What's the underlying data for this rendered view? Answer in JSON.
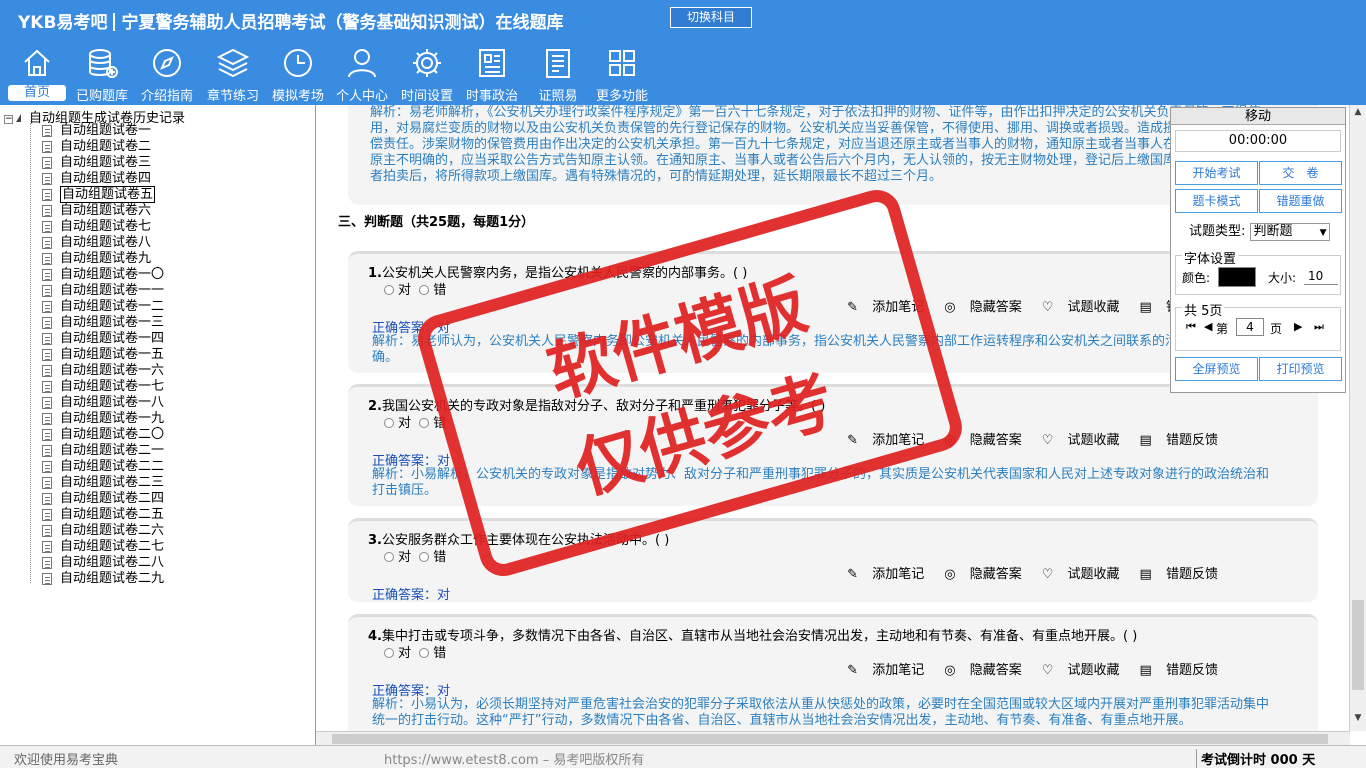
{
  "header": {
    "logo": "YKB易考吧",
    "title": "宁夏警务辅助人员招聘考试（警务基础知识测试）在线题库",
    "switch_label": "切换科目"
  },
  "nav": [
    {
      "label": "首页",
      "icon": "home-icon"
    },
    {
      "label": "已购题库",
      "icon": "database-icon"
    },
    {
      "label": "介绍指南",
      "icon": "compass-icon"
    },
    {
      "label": "章节练习",
      "icon": "layers-icon"
    },
    {
      "label": "模拟考场",
      "icon": "clock-icon"
    },
    {
      "label": "个人中心",
      "icon": "user-icon"
    },
    {
      "label": "时间设置",
      "icon": "gear-icon"
    },
    {
      "label": "时事政治",
      "icon": "news-icon"
    },
    {
      "label": "证照易",
      "icon": "certificate-icon"
    },
    {
      "label": "更多功能",
      "icon": "grid-icon"
    }
  ],
  "tree": {
    "root": "自动组题生成试卷历史记录",
    "items": [
      "自动组题试卷一",
      "自动组题试卷二",
      "自动组题试卷三",
      "自动组题试卷四",
      "自动组题试卷五",
      "自动组题试卷六",
      "自动组题试卷七",
      "自动组题试卷八",
      "自动组题试卷九",
      "自动组题试卷一〇",
      "自动组题试卷一一",
      "自动组题试卷一二",
      "自动组题试卷一三",
      "自动组题试卷一四",
      "自动组题试卷一五",
      "自动组题试卷一六",
      "自动组题试卷一七",
      "自动组题试卷一八",
      "自动组题试卷一九",
      "自动组题试卷二〇",
      "自动组题试卷二一",
      "自动组题试卷二二",
      "自动组题试卷二三",
      "自动组题试卷二四",
      "自动组题试卷二五",
      "自动组题试卷二六",
      "自动组题试卷二七",
      "自动组题试卷二八",
      "自动组题试卷二九"
    ],
    "selected_index": 4
  },
  "main": {
    "prev_explanation": "解析：易老师解析，《公安机关办理行政案件程序规定》第一百六十七条规定，对于依法扣押的财物、证件等，由作出扣押决定的公安机关负责保管，不得使用，对易腐烂变质的财物以及由公安机关负责保管的先行登记保存的财物。公安机关应当妥善保管，不得使用、挪用、调换或者损毁。造成损失的，应当承担赔偿责任。涉案财物的保管费用由作出决定的公安机关承担。第一百九十七条规定，对应当退还原主或者当事人的财物，通知原主或者当事人在六个月内来领取；原主不明确的，应当采取公告方式告知原主认领。在通知原主、当事人或者公告后六个月内，无人认领的，按无主财物处理，登记后上缴国库，或者依法变卖或者拍卖后，将所得款项上缴国库。遇有特殊情况的，可酌情延期处理，延长期限最长不超过三个月。",
    "section_title": "三、判断题（共25题，每题1分）",
    "option_true": "对",
    "option_false": "错",
    "tool_note": "添加笔记",
    "tool_hide": "隐藏答案",
    "tool_fav": "试题收藏",
    "tool_report": "错题反馈",
    "questions": [
      {
        "num": "1.",
        "text": "公安机关人民警察内务，是指公安机关人民警察的内部事务。( )",
        "answer": "正确答案：对",
        "explanation": "解析：易老师认为，公安机关人民警察内务即公安机关人民警察的内部事务，指公安机关人民警察内部工作运转程序和公安机关之间联系的活动。故题说法正确。"
      },
      {
        "num": "2.",
        "text": "我国公安机关的专政对象是指敌对分子、敌对分子和严重刑事犯罪分子等。( )",
        "answer": "正确答案：对",
        "explanation": "解析：小易解析，公安机关的专政对象是指敌对势力、敌对分子和严重刑事犯罪分子的，其实质是公安机关代表国家和人民对上述专政对象进行的政治统治和打击镇压。"
      },
      {
        "num": "3.",
        "text": "公安服务群众工作主要体现在公安执法活动中。( )",
        "answer": "正确答案：对",
        "explanation": ""
      },
      {
        "num": "4.",
        "text": "集中打击或专项斗争，多数情况下由各省、自治区、直辖市从当地社会治安情况出发，主动地和有节奏、有准备、有重点地开展。( )",
        "answer": "正确答案：对",
        "explanation": "解析：小易认为，必须长期坚持对严重危害社会治安的犯罪分子采取依法从重从快惩处的政策，必要时在全国范围或较大区域内开展对严重刑事犯罪活动集中统一的打击行动。这种“严打”行动，多数情况下由各省、自治区、直辖市从当地社会治安情况出发，主动地、有节奏、有准备、有重点地开展。"
      }
    ]
  },
  "panel": {
    "title": "移动",
    "timer": "00:00:00",
    "btn_start": "开始考试",
    "btn_submit": "交　卷",
    "btn_card": "题卡模式",
    "btn_redo": "错题重做",
    "qtype_label": "试题类型:",
    "qtype_value": "判断题",
    "font_group": "字体设置",
    "color_label": "颜色:",
    "color_value": "#000000",
    "size_label": "大小:",
    "size_value": "10",
    "pages_group": "共 5页",
    "page_prefix": "第",
    "page_value": "4",
    "page_suffix": "页",
    "btn_full": "全屏预览",
    "btn_print": "打印预览"
  },
  "stamp": {
    "line1": "软件模版",
    "line2": "仅供参考",
    "color": "#e02020"
  },
  "status": {
    "left": "欢迎使用易考宝典",
    "mid": "https://www.etest8.com – 易考吧版权所有",
    "right": "考试倒计时 000 天"
  },
  "colors": {
    "header_bg": "#3a8ce0",
    "accent": "#2d7ad6",
    "explanation": "#2c7fc0",
    "answer": "#1a4fb8"
  }
}
